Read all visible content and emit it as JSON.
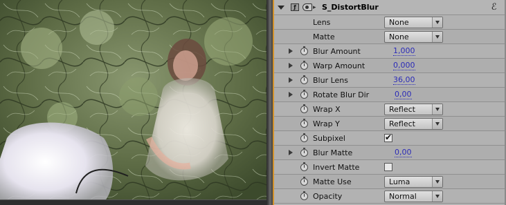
{
  "effect": {
    "name": "S_DistortBlur",
    "fx_icon": "fx-toggle-icon",
    "settings_icon": "swirl-settings-icon"
  },
  "params": [
    {
      "id": "lens",
      "label": "Lens",
      "kind": "dropdown",
      "value": "None",
      "twirl": false,
      "stopwatch": false
    },
    {
      "id": "matte",
      "label": "Matte",
      "kind": "dropdown",
      "value": "None",
      "twirl": false,
      "stopwatch": false
    },
    {
      "id": "blur-amount",
      "label": "Blur Amount",
      "kind": "number",
      "value": "1,000",
      "twirl": true,
      "stopwatch": true
    },
    {
      "id": "warp-amount",
      "label": "Warp Amount",
      "kind": "number",
      "value": "0,000",
      "twirl": true,
      "stopwatch": true
    },
    {
      "id": "blur-lens",
      "label": "Blur Lens",
      "kind": "number",
      "value": "36,00",
      "twirl": true,
      "stopwatch": true
    },
    {
      "id": "rotate-blur-dir",
      "label": "Rotate Blur Dir",
      "kind": "number",
      "value": "0,00",
      "twirl": true,
      "stopwatch": true
    },
    {
      "id": "wrap-x",
      "label": "Wrap X",
      "kind": "dropdown",
      "value": "Reflect",
      "twirl": false,
      "stopwatch": true
    },
    {
      "id": "wrap-y",
      "label": "Wrap Y",
      "kind": "dropdown",
      "value": "Reflect",
      "twirl": false,
      "stopwatch": true
    },
    {
      "id": "subpixel",
      "label": "Subpixel",
      "kind": "checkbox",
      "checked": true,
      "twirl": false,
      "stopwatch": true
    },
    {
      "id": "blur-matte",
      "label": "Blur Matte",
      "kind": "number",
      "value": "0,00",
      "twirl": true,
      "stopwatch": true
    },
    {
      "id": "invert-matte",
      "label": "Invert Matte",
      "kind": "checkbox",
      "checked": false,
      "twirl": false,
      "stopwatch": true
    },
    {
      "id": "matte-use",
      "label": "Matte Use",
      "kind": "dropdown",
      "value": "Luma",
      "twirl": false,
      "stopwatch": true
    },
    {
      "id": "opacity",
      "label": "Opacity",
      "kind": "dropdown",
      "value": "Normal",
      "twirl": false,
      "stopwatch": true
    }
  ],
  "colors": {
    "panel_bg": "#b2b2b2",
    "value_link": "#2b2bb8",
    "accent_edge": "#d3922c"
  }
}
